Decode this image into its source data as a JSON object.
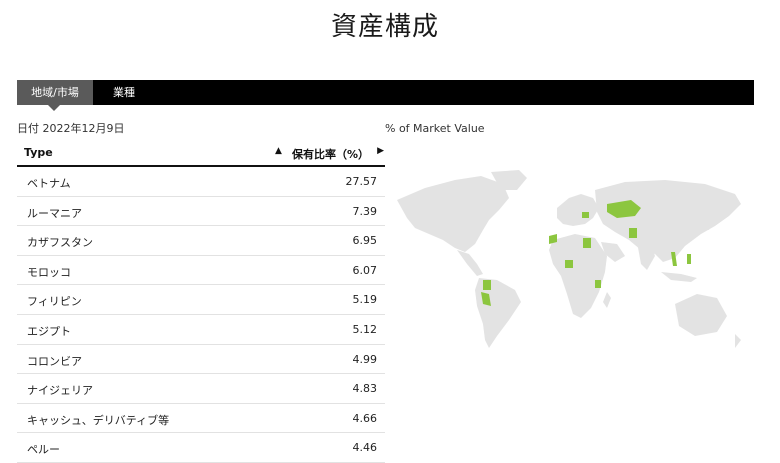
{
  "title": "資産構成",
  "tabs": [
    {
      "label": "地域/市場",
      "active": true
    },
    {
      "label": "業種",
      "active": false
    }
  ],
  "date_text": "日付 2022年12月9日",
  "map": {
    "title": "% of Market Value",
    "land_color": "#e3e3e3",
    "highlight_color": "#8cc63f"
  },
  "table": {
    "columns": {
      "type": "Type",
      "ratio": "保有比率（%）"
    },
    "sort_icons": {
      "type": "▲",
      "ratio": "▶"
    },
    "rows": [
      {
        "name": "ベトナム",
        "value": "27.57"
      },
      {
        "name": "ルーマニア",
        "value": "7.39"
      },
      {
        "name": "カザフスタン",
        "value": "6.95"
      },
      {
        "name": "モロッコ",
        "value": "6.07"
      },
      {
        "name": "フィリピン",
        "value": "5.19"
      },
      {
        "name": "エジプト",
        "value": "5.12"
      },
      {
        "name": "コロンビア",
        "value": "4.99"
      },
      {
        "name": "ナイジェリア",
        "value": "4.83"
      },
      {
        "name": "キャッシュ、デリバティブ等",
        "value": "4.66"
      },
      {
        "name": "ペルー",
        "value": "4.46"
      }
    ]
  }
}
